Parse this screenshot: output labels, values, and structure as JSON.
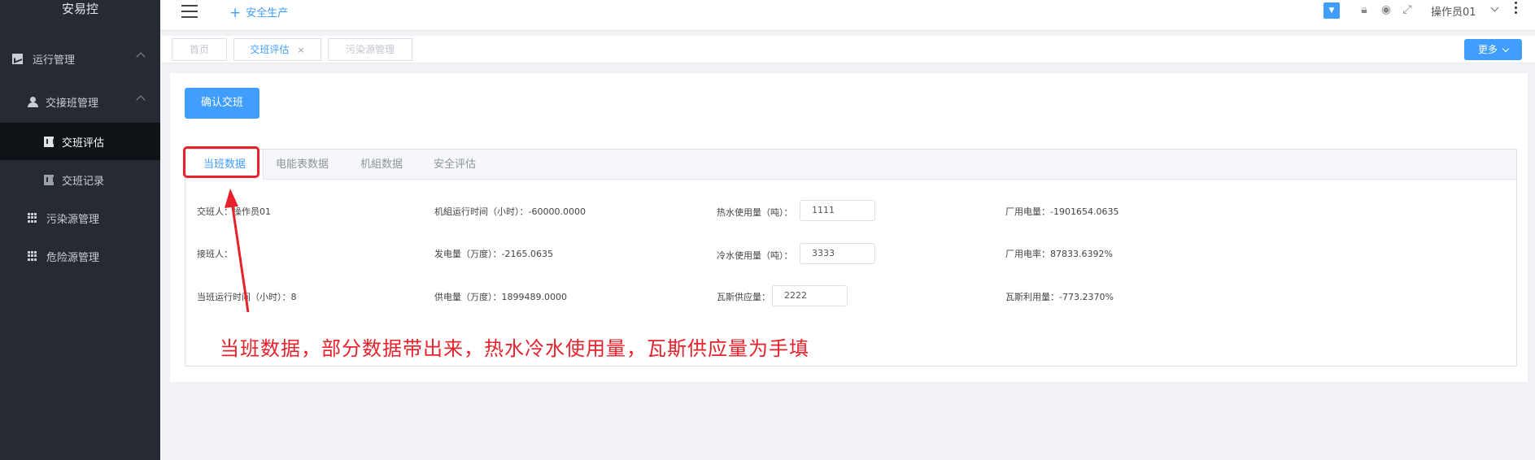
{
  "app": {
    "brand": "安易控"
  },
  "sidebar": {
    "items": [
      {
        "label": "运行管理"
      },
      {
        "label": "交接班管理"
      },
      {
        "label": "交班评估"
      },
      {
        "label": "交班记录"
      },
      {
        "label": "污染源管理"
      },
      {
        "label": "危险源管理"
      }
    ]
  },
  "header": {
    "link_label": "安全生产",
    "operator": "操作员01"
  },
  "tags": {
    "items": [
      "首页",
      "交班评估",
      "污染源管理"
    ],
    "more_label": "更多"
  },
  "main": {
    "confirm_label": "确认交班",
    "tabs": [
      "当班数据",
      "电能表数据",
      "机組数据",
      "安全评估"
    ],
    "fields": {
      "handover_label": "交班人：",
      "handover_value": "操作员01",
      "machine_time_label": "机組运行时间（小时）：",
      "machine_time_value": "-60000.0000",
      "hot_water_label": "热水使用量（吨）：",
      "hot_water_value": "1111",
      "plant_power_label": "厂用电量：",
      "plant_power_value": "-1901654.0635",
      "receiver_label": "接班人：",
      "receiver_value": "",
      "generation_label": "发电量（万度）：",
      "generation_value": "-2165.0635",
      "cold_water_label": "冷水使用量（吨）：",
      "cold_water_value": "3333",
      "plant_power_rate_label": "厂用电率：",
      "plant_power_rate_value": "87833.6392%",
      "shift_time_label": "当班运行时间（小时）：",
      "shift_time_value": "8",
      "supply_label": "供电量（万度）：",
      "supply_value": "1899489.0000",
      "gas_supply_label": "瓦斯供应量：",
      "gas_supply_value": "2222",
      "gas_util_label": "瓦斯利用量：",
      "gas_util_value": "-773.2370%"
    }
  },
  "annotation": {
    "text": "当班数据，部分数据带出来，热水冷水使用量，瓦斯供应量为手填",
    "color": "#e8212a"
  },
  "colors": {
    "accent": "#409eff",
    "sidebar_bg": "#252a33"
  }
}
